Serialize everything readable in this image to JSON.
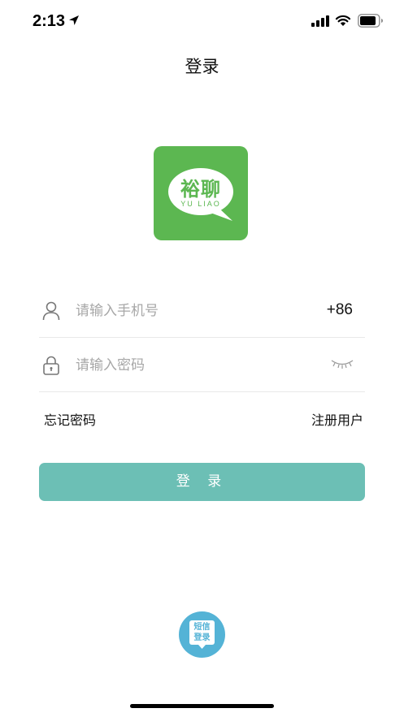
{
  "status_bar": {
    "time": "2:13"
  },
  "nav": {
    "title": "登录"
  },
  "logo": {
    "cn_text": "裕聊",
    "en_text": "YU LIAO"
  },
  "form": {
    "phone_placeholder": "请输入手机号",
    "country_code": "+86",
    "password_placeholder": "请输入密码"
  },
  "links": {
    "forgot_password": "忘记密码",
    "register": "注册用户"
  },
  "login_button": {
    "label": "登 录"
  },
  "sms_login": {
    "line1": "短信",
    "line2": "登录"
  },
  "colors": {
    "logo_green": "#5cb751",
    "button_teal": "#6cbfb5",
    "sms_blue": "#54b3d6"
  }
}
